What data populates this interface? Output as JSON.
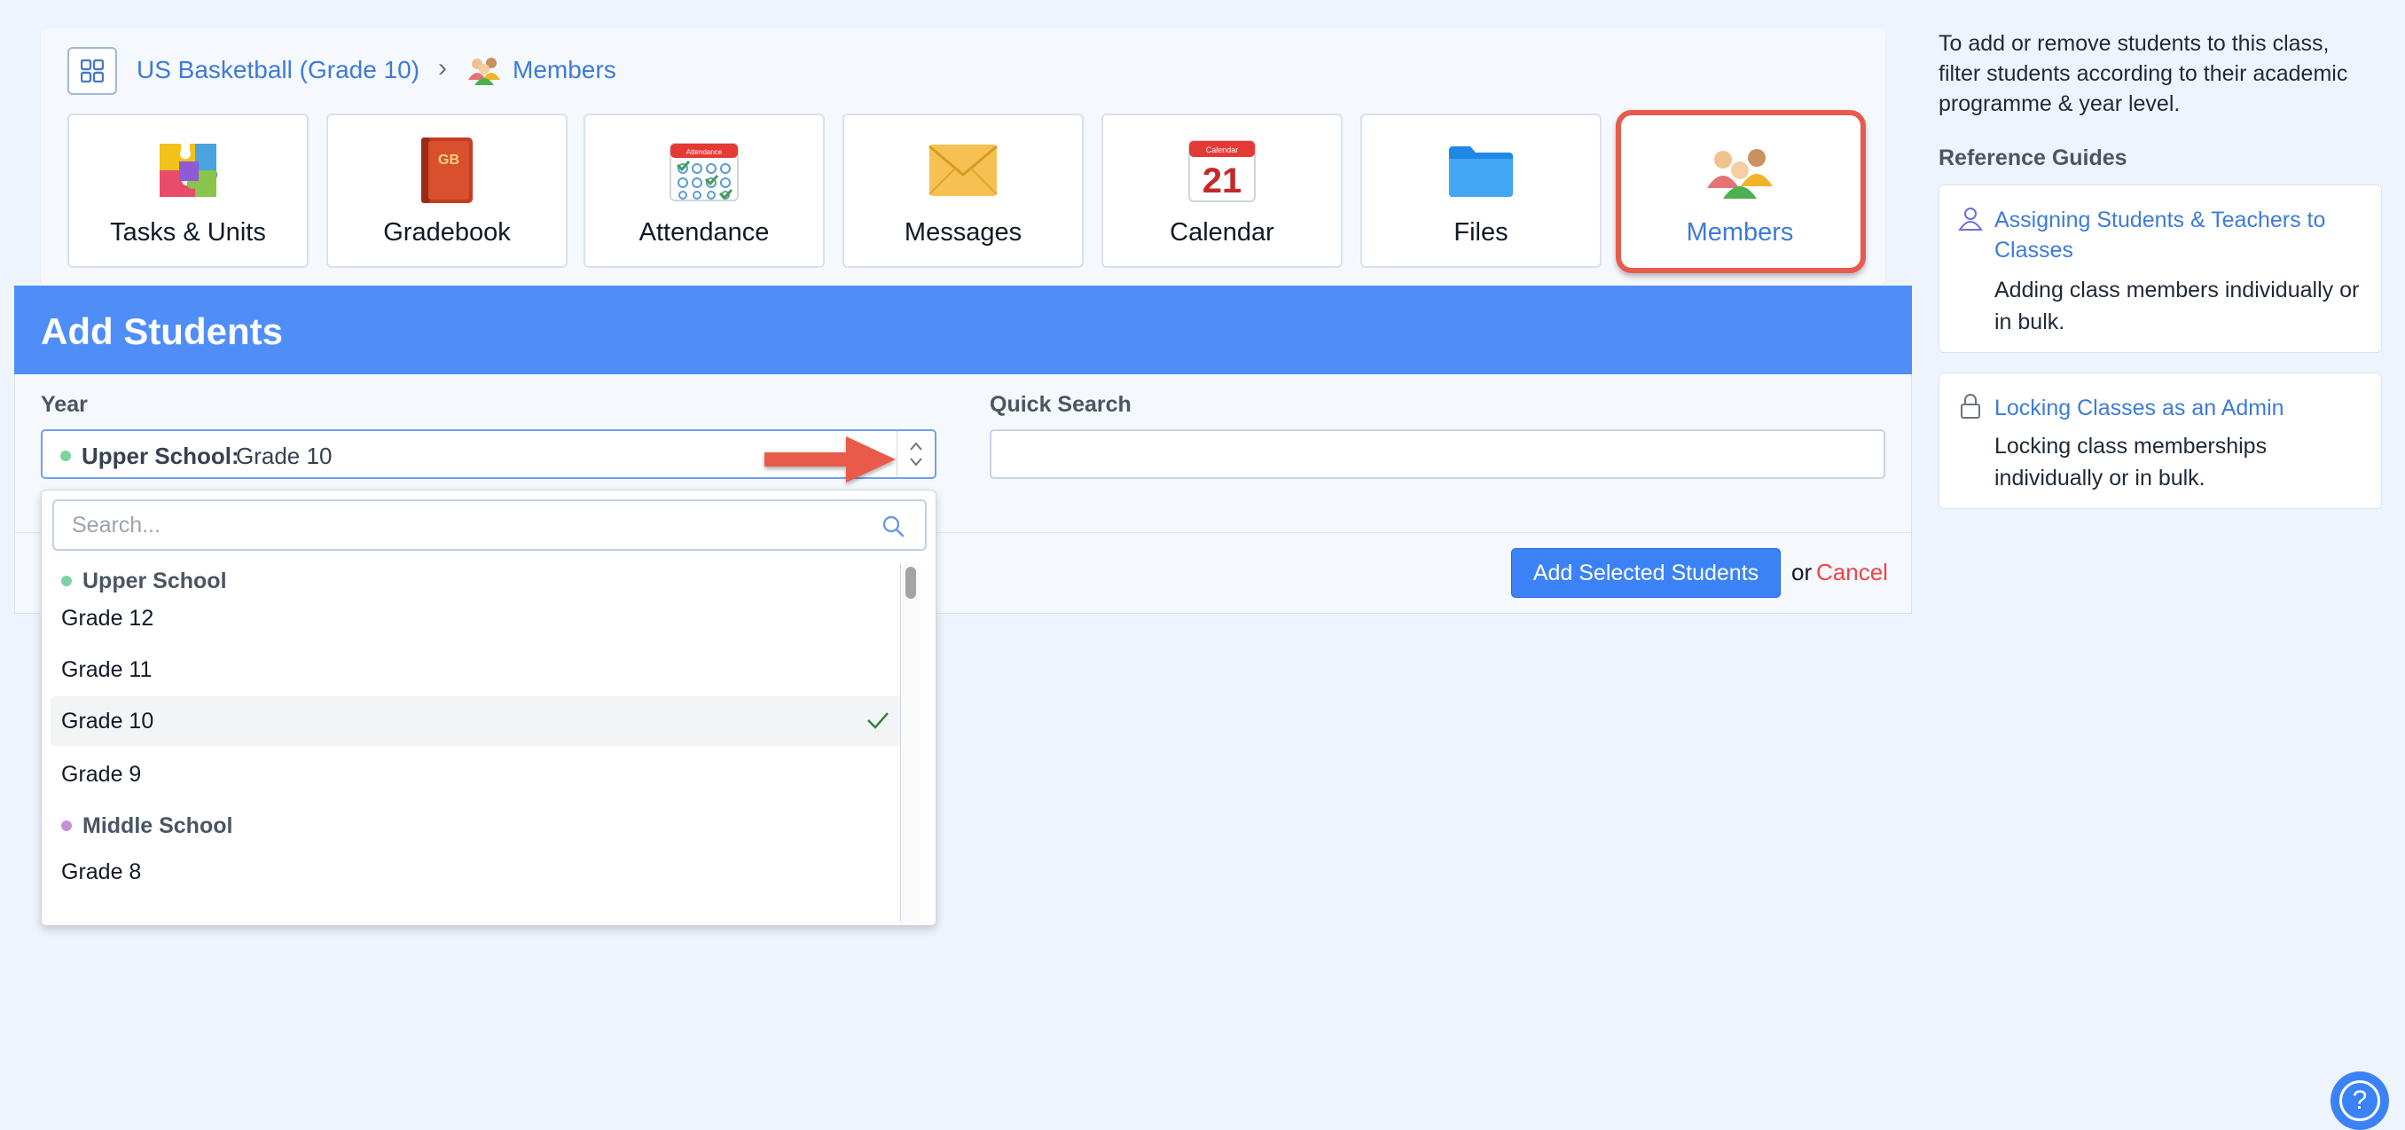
{
  "breadcrumb": {
    "class_link": "US Basketball (Grade 10)",
    "separator": "›",
    "current": "Members"
  },
  "tools": [
    {
      "label": "Tasks & Units",
      "icon": "puzzle-icon"
    },
    {
      "label": "Gradebook",
      "icon": "gradebook-icon"
    },
    {
      "label": "Attendance",
      "icon": "attendance-icon"
    },
    {
      "label": "Messages",
      "icon": "envelope-icon"
    },
    {
      "label": "Calendar",
      "icon": "calendar-icon"
    },
    {
      "label": "Files",
      "icon": "folder-icon"
    },
    {
      "label": "Members",
      "icon": "members-icon",
      "active": true
    }
  ],
  "gradebook_icon_text": "GB",
  "attendance_icon_text": "Attendance",
  "calendar_icon": {
    "header": "Calendar",
    "day": "21"
  },
  "panel": {
    "title": "Add Students",
    "year_label": "Year",
    "quick_search_label": "Quick Search",
    "year_value": {
      "group": "Upper School:",
      "value": "Grade 10"
    },
    "quick_search_value": "",
    "add_button": "Add Selected Students",
    "or_text": "or",
    "cancel": "Cancel"
  },
  "dropdown": {
    "search_placeholder": "Search...",
    "groups": [
      {
        "name": "Upper School",
        "dot_color": "#7dd3a0"
      },
      {
        "name": "Middle School",
        "dot_color": "#c98fd6"
      }
    ],
    "options": [
      "Grade 12",
      "Grade 11",
      "Grade 10",
      "Grade 9",
      "Grade 8"
    ],
    "selected": "Grade 10"
  },
  "sidebar": {
    "intro": "To add or remove students to this class, filter students according to their academic programme & year level.",
    "reference_title": "Reference Guides",
    "guides": [
      {
        "title": "Assigning Students & Teachers to Classes",
        "description": "Adding class members individually or in bulk.",
        "icon": "user-outline-icon"
      },
      {
        "title": "Locking Classes as an Admin",
        "description": "Locking class memberships individually or in bulk.",
        "icon": "lock-icon"
      }
    ]
  },
  "help": {
    "label": "?"
  },
  "colors": {
    "accent": "#4f8ef7",
    "link": "#3d7bd9",
    "cancel": "#ef4444",
    "highlight": "#e8594e"
  }
}
